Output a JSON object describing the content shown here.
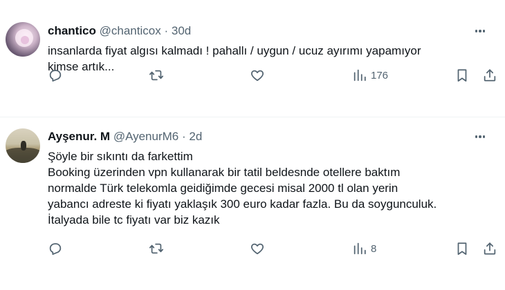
{
  "tweets": [
    {
      "name": "chantico",
      "handle": "@chanticox",
      "separator": "·",
      "time": "30d",
      "text": "insanlarda fiyat algısı kalmadı !  pahallı / uygun / ucuz ayırımı yapamıyor\nkimse artık...",
      "views": "176"
    },
    {
      "name": "Ayşenur. M",
      "handle": "@AyenurM6",
      "separator": "·",
      "time": "2d",
      "text": "Şöyle bir sıkıntı da farkettim\nBooking üzerinden vpn kullanarak bir tatil beldesnde otellere baktım\nnormalde Türk telekomla geidiğimde gecesi misal 2000 tl olan yerin\nyabancı adreste ki fiyatı yaklaşık 300 euro kadar fazla. Bu da soygunculuk.\nİtalyada bile tc fiyatı var biz kazık",
      "views": "8"
    }
  ],
  "icons": {
    "reply": "reply-icon",
    "retweet": "retweet-icon",
    "like": "heart-icon",
    "views": "views-bar-chart-icon",
    "bookmark": "bookmark-icon",
    "share": "share-icon",
    "more": "more-dots-icon"
  },
  "colors": {
    "text": "#0f1419",
    "secondary": "#536471",
    "divider": "#eff3f4",
    "background": "#ffffff"
  }
}
